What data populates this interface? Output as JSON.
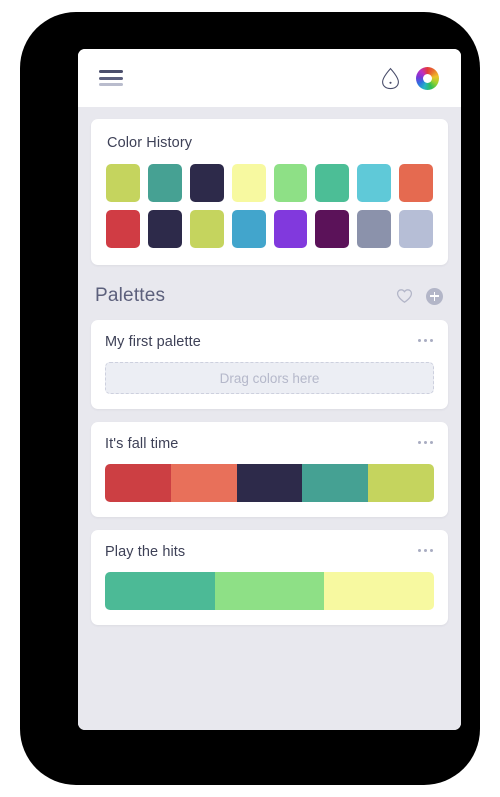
{
  "header": {
    "menu_icon": "hamburger-menu-icon",
    "droplet_icon": "droplet-icon",
    "color_wheel_icon": "color-wheel-icon"
  },
  "color_history": {
    "title": "Color History",
    "rows": [
      [
        "#c5d45e",
        "#46a193",
        "#2d2a4a",
        "#f7f9a0",
        "#8ee086",
        "#4cbe96",
        "#5fc9d8",
        "#e56a50"
      ],
      [
        "#d03c44",
        "#2d2a4a",
        "#c5d45e",
        "#42a5cc",
        "#8139dd",
        "#5b1259",
        "#8b92ab",
        "#b6bed6"
      ]
    ]
  },
  "palettes_section": {
    "title": "Palettes",
    "favorite_icon": "heart-icon",
    "add_icon": "plus-icon",
    "cards": [
      {
        "name": "My first palette",
        "menu_icon": "more-options-icon",
        "empty": true,
        "dropzone_text": "Drag colors here",
        "colors": []
      },
      {
        "name": "It's fall time",
        "menu_icon": "more-options-icon",
        "empty": false,
        "dropzone_text": "",
        "colors": [
          "#cc3f43",
          "#e8705a",
          "#2d2a4a",
          "#45a193",
          "#c5d45e"
        ]
      },
      {
        "name": "Play the hits",
        "menu_icon": "more-options-icon",
        "empty": false,
        "dropzone_text": "",
        "colors": [
          "#4cba96",
          "#8ee086",
          "#f7f9a0"
        ]
      }
    ]
  }
}
